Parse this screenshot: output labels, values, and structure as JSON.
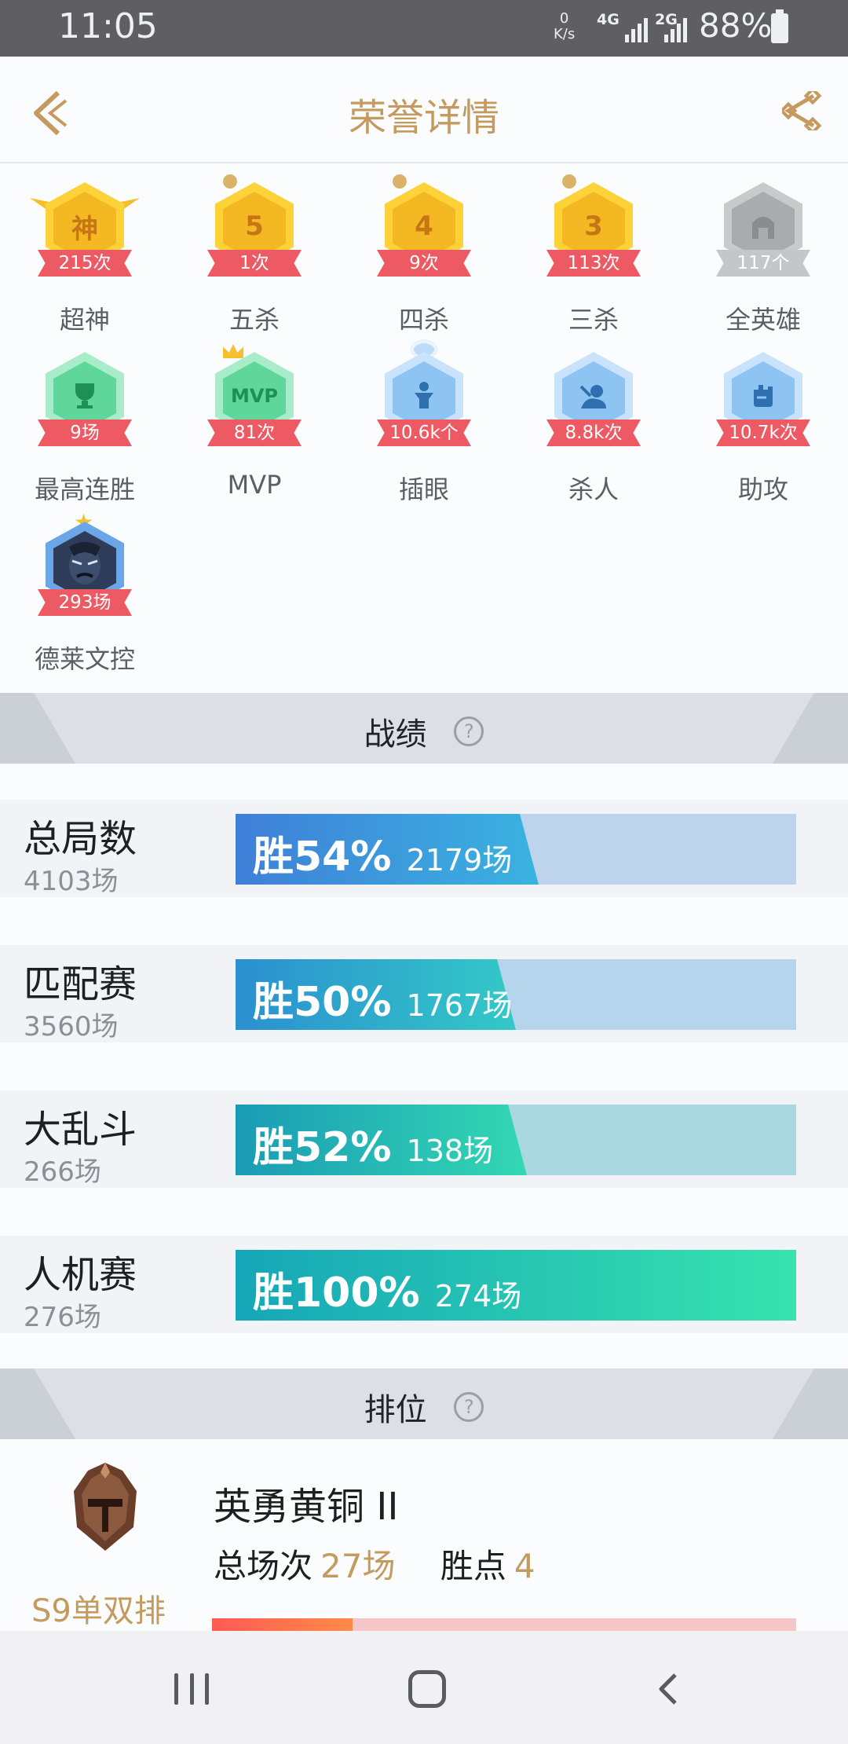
{
  "status_bar": {
    "time": "11:05",
    "net_speed_value": "0",
    "net_speed_unit": "K/s",
    "signal_1": "4G",
    "signal_2": "2G",
    "battery": "88%"
  },
  "header": {
    "title": "荣誉详情"
  },
  "honors": [
    {
      "label": "超神",
      "count": "215次",
      "glyph": "神",
      "style": "gold"
    },
    {
      "label": "五杀",
      "count": "1次",
      "glyph": "5",
      "style": "gold"
    },
    {
      "label": "四杀",
      "count": "9次",
      "glyph": "4",
      "style": "gold"
    },
    {
      "label": "三杀",
      "count": "113次",
      "glyph": "3",
      "style": "gold"
    },
    {
      "label": "全英雄",
      "count": "117个",
      "glyph": "",
      "style": "grey"
    },
    {
      "label": "最高连胜",
      "count": "9场",
      "glyph": "",
      "style": "green"
    },
    {
      "label": "MVP",
      "count": "81次",
      "glyph": "MVP",
      "style": "green"
    },
    {
      "label": "插眼",
      "count": "10.6k个",
      "glyph": "",
      "style": "blue"
    },
    {
      "label": "杀人",
      "count": "8.8k次",
      "glyph": "",
      "style": "blue"
    },
    {
      "label": "助攻",
      "count": "10.7k次",
      "glyph": "",
      "style": "blue"
    },
    {
      "label": "德莱文控",
      "count": "293场",
      "glyph": "",
      "style": "hero"
    }
  ],
  "record_section": {
    "title": "战绩"
  },
  "stats": [
    {
      "name": "总局数",
      "total": "4103场",
      "win_label": "胜54%",
      "win_games": "2179场",
      "win_rate": 0.54,
      "fill_from": "#3f7fd8",
      "fill_to": "#3ab3e0",
      "bg": "#bed3ec"
    },
    {
      "name": "匹配赛",
      "total": "3560场",
      "win_label": "胜50%",
      "win_games": "1767场",
      "win_rate": 0.5,
      "fill_from": "#2b8fd0",
      "fill_to": "#33c9c7",
      "bg": "#b5d5ec"
    },
    {
      "name": "大乱斗",
      "total": "266场",
      "win_label": "胜52%",
      "win_games": "138场",
      "win_rate": 0.52,
      "fill_from": "#1a9bb5",
      "fill_to": "#33d8b3",
      "bg": "#a9d8e1"
    },
    {
      "name": "人机赛",
      "total": "276场",
      "win_label": "胜100%",
      "win_games": "274场",
      "win_rate": 1.0,
      "fill_from": "#16a6b8",
      "fill_to": "#37e3ad",
      "bg": "#a9e0d6"
    }
  ],
  "ranked_section": {
    "title": "排位"
  },
  "ranked": {
    "season": "S9单双排",
    "tier": "英勇黄铜 II",
    "total_label": "总场次",
    "total_value": "27场",
    "points_label": "胜点",
    "points_value": "4",
    "progress": 0.24
  }
}
